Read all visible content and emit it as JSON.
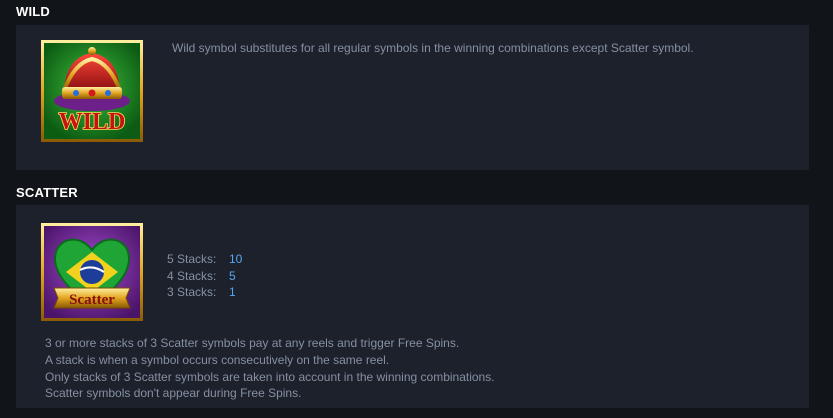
{
  "wild": {
    "title": "WILD",
    "symbol_text": "WILD",
    "description": "Wild symbol substitutes for all regular symbols in the winning combinations except Scatter symbol."
  },
  "scatter": {
    "title": "SCATTER",
    "symbol_text": "Scatter",
    "paytable": [
      {
        "label": "5 Stacks:",
        "value": "10"
      },
      {
        "label": "4 Stacks:",
        "value": "5"
      },
      {
        "label": "3 Stacks:",
        "value": "1"
      }
    ],
    "notes": [
      "3 or more stacks of 3 Scatter symbols pay at any reels and trigger Free Spins.",
      "A stack is when a symbol occurs consecutively on the same reel.",
      "Only stacks of 3 Scatter symbols are taken into account in the winning combinations.",
      "Scatter symbols don't appear during Free Spins."
    ]
  },
  "colors": {
    "background": "#111419",
    "panel": "#1d212b",
    "text": "#8590a3",
    "value": "#5aa6f0",
    "title": "#ffffff"
  }
}
